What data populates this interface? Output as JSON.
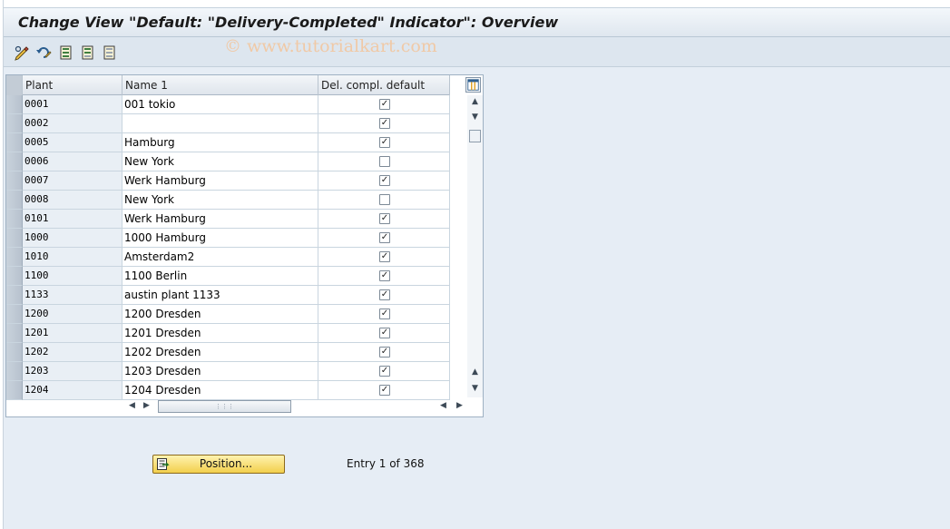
{
  "window": {
    "title": "Change View \"Default: \"Delivery-Completed\" Indicator\": Overview",
    "watermark": "© www.tutorialkart.com"
  },
  "toolbar": {
    "icons": [
      "display-change-icon",
      "undo-icon",
      "select-all-icon",
      "select-block-icon",
      "deselect-all-icon"
    ]
  },
  "table": {
    "columns": [
      "Plant",
      "Name 1",
      "Del. compl. default"
    ],
    "rows": [
      {
        "plant": "0001",
        "name": "001 tokio",
        "checked": true
      },
      {
        "plant": "0002",
        "name": "",
        "checked": true
      },
      {
        "plant": "0005",
        "name": "Hamburg",
        "checked": true
      },
      {
        "plant": "0006",
        "name": "New York",
        "checked": false
      },
      {
        "plant": "0007",
        "name": "Werk Hamburg",
        "checked": true
      },
      {
        "plant": "0008",
        "name": "New York",
        "checked": false
      },
      {
        "plant": "0101",
        "name": "Werk Hamburg",
        "checked": true
      },
      {
        "plant": "1000",
        "name": "1000 Hamburg",
        "checked": true
      },
      {
        "plant": "1010",
        "name": "Amsterdam2",
        "checked": true
      },
      {
        "plant": "1100",
        "name": "1100 Berlin",
        "checked": true
      },
      {
        "plant": "1133",
        "name": "austin plant 1133",
        "checked": true
      },
      {
        "plant": "1200",
        "name": "1200 Dresden",
        "checked": true
      },
      {
        "plant": "1201",
        "name": "1201 Dresden",
        "checked": true
      },
      {
        "plant": "1202",
        "name": "1202 Dresden",
        "checked": true
      },
      {
        "plant": "1203",
        "name": "1203 Dresden",
        "checked": true
      },
      {
        "plant": "1204",
        "name": "1204 Dresden",
        "checked": true
      }
    ]
  },
  "footer": {
    "position_button": "Position...",
    "entry_text": "Entry 1 of 368"
  },
  "colors": {
    "background": "#e6edf5",
    "button": "#f2cf4c",
    "plant_cell": "#e9eff5"
  }
}
